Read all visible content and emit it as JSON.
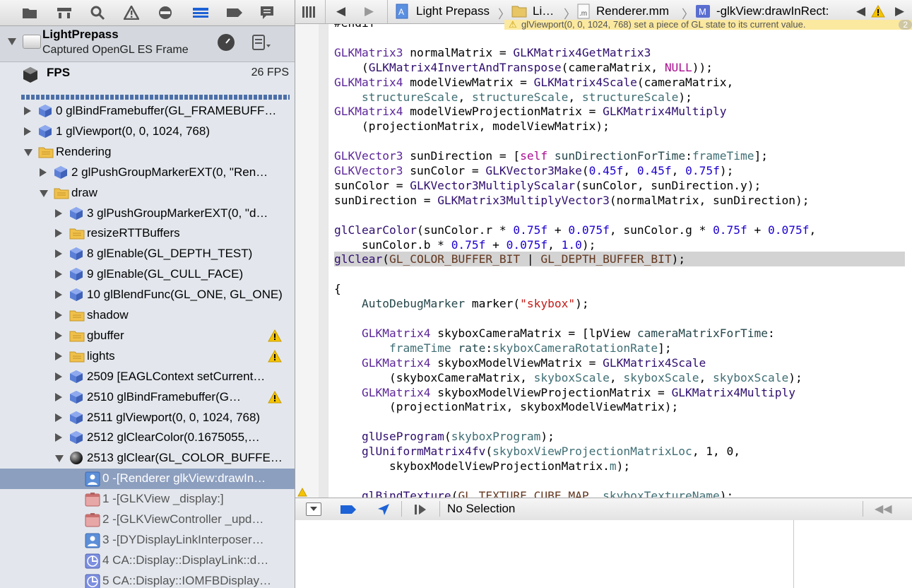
{
  "navigator": {
    "toolbar_icons": [
      "folder-icon",
      "hierarchy-icon",
      "search-icon",
      "warning-icon",
      "breakpoint-filter-icon",
      "debug-navigator-icon",
      "breakpoint-icon",
      "log-icon"
    ],
    "frame_title": "LightPrepass",
    "frame_subtitle": "Captured OpenGL ES Frame",
    "fps_label": "FPS",
    "fps_value": "26 FPS",
    "tree": [
      {
        "label": "0 glBindFramebuffer(GL_FRAMEBUFF…",
        "icon": "cube-icon",
        "indent": 0,
        "disclosure": "closed"
      },
      {
        "label": "1 glViewport(0, 0, 1024, 768)",
        "icon": "cube-icon",
        "indent": 0,
        "disclosure": "closed"
      },
      {
        "label": "Rendering",
        "icon": "folder-icon",
        "indent": 0,
        "disclosure": "open"
      },
      {
        "label": "2 glPushGroupMarkerEXT(0, \"Ren…",
        "icon": "cube-icon",
        "indent": 1,
        "disclosure": "closed"
      },
      {
        "label": "draw",
        "icon": "folder-icon",
        "indent": 1,
        "disclosure": "open"
      },
      {
        "label": "3 glPushGroupMarkerEXT(0, \"d…",
        "icon": "cube-icon",
        "indent": 2,
        "disclosure": "closed"
      },
      {
        "label": "resizeRTTBuffers",
        "icon": "folder-icon",
        "indent": 2,
        "disclosure": "closed"
      },
      {
        "label": "8 glEnable(GL_DEPTH_TEST)",
        "icon": "cube-icon",
        "indent": 2,
        "disclosure": "closed"
      },
      {
        "label": "9 glEnable(GL_CULL_FACE)",
        "icon": "cube-icon",
        "indent": 2,
        "disclosure": "closed"
      },
      {
        "label": "10 glBlendFunc(GL_ONE, GL_ONE)",
        "icon": "cube-icon",
        "indent": 2,
        "disclosure": "closed"
      },
      {
        "label": "shadow",
        "icon": "folder-icon",
        "indent": 2,
        "disclosure": "closed"
      },
      {
        "label": "gbuffer",
        "icon": "folder-icon",
        "indent": 2,
        "disclosure": "closed",
        "warning": true
      },
      {
        "label": "lights",
        "icon": "folder-icon",
        "indent": 2,
        "disclosure": "closed",
        "warning": true
      },
      {
        "label": "2509 [EAGLContext setCurrent…",
        "icon": "cube-icon",
        "indent": 2,
        "disclosure": "closed"
      },
      {
        "label": "2510 glBindFramebuffer(G…",
        "icon": "cube-icon",
        "indent": 2,
        "disclosure": "closed",
        "warning": true
      },
      {
        "label": "2511 glViewport(0, 0, 1024, 768)",
        "icon": "cube-icon",
        "indent": 2,
        "disclosure": "closed"
      },
      {
        "label": "2512 glClearColor(0.1675055,…",
        "icon": "cube-icon",
        "indent": 2,
        "disclosure": "closed"
      },
      {
        "label": "2513 glClear(GL_COLOR_BUFFE…",
        "icon": "sphere-icon",
        "indent": 2,
        "disclosure": "open"
      },
      {
        "label": "0 -[Renderer glkView:drawIn…",
        "icon": "user-frame-icon",
        "indent": 3,
        "disclosure": "none",
        "selected": true
      },
      {
        "label": "1 -[GLKView _display:]",
        "icon": "framework-icon",
        "indent": 3,
        "disclosure": "none",
        "dim": true
      },
      {
        "label": "2 -[GLKViewController _upd…",
        "icon": "framework-icon",
        "indent": 3,
        "disclosure": "none",
        "dim": true
      },
      {
        "label": "3 -[DYDisplayLinkInterposer…",
        "icon": "user-frame-icon",
        "indent": 3,
        "disclosure": "none",
        "dim": true
      },
      {
        "label": "4 CA::Display::DisplayLink::d…",
        "icon": "system-frame-icon",
        "indent": 3,
        "disclosure": "none",
        "dim": true
      },
      {
        "label": "5 CA::Display::IOMFBDisplay…",
        "icon": "system-frame-icon",
        "indent": 3,
        "disclosure": "none",
        "dim": true
      }
    ]
  },
  "jumpbar": {
    "project": "Light Prepass",
    "folder": "Li…",
    "file": "Renderer.mm",
    "method": "-glkView:drawInRect:"
  },
  "issue_banner": {
    "text": "glViewport(0, 0, 1024, 768) set a piece of GL state to its current value.",
    "count": "2"
  },
  "code_lines": [
    [
      {
        "c": "",
        "t": "#endif"
      }
    ],
    [],
    [
      {
        "c": "t",
        "t": "GLKMatrix3"
      },
      {
        "c": "",
        "t": " normalMatrix = "
      },
      {
        "c": "f",
        "t": "GLKMatrix4GetMatrix3"
      }
    ],
    [
      {
        "c": "",
        "t": "    ("
      },
      {
        "c": "f",
        "t": "GLKMatrix4InvertAndTranspose"
      },
      {
        "c": "",
        "t": "(cameraMatrix, "
      },
      {
        "c": "kw",
        "t": "NULL"
      },
      {
        "c": "",
        "t": "));"
      }
    ],
    [
      {
        "c": "t",
        "t": "GLKMatrix4"
      },
      {
        "c": "",
        "t": " modelViewMatrix = "
      },
      {
        "c": "f",
        "t": "GLKMatrix4Scale"
      },
      {
        "c": "",
        "t": "(cameraMatrix,"
      }
    ],
    [
      {
        "c": "",
        "t": "    "
      },
      {
        "c": "m",
        "t": "structureScale"
      },
      {
        "c": "",
        "t": ", "
      },
      {
        "c": "m",
        "t": "structureScale"
      },
      {
        "c": "",
        "t": ", "
      },
      {
        "c": "m",
        "t": "structureScale"
      },
      {
        "c": "",
        "t": ");"
      }
    ],
    [
      {
        "c": "t",
        "t": "GLKMatrix4"
      },
      {
        "c": "",
        "t": " modelViewProjectionMatrix = "
      },
      {
        "c": "f",
        "t": "GLKMatrix4Multiply"
      }
    ],
    [
      {
        "c": "",
        "t": "    (projectionMatrix, modelViewMatrix);"
      }
    ],
    [],
    [
      {
        "c": "t",
        "t": "GLKVector3"
      },
      {
        "c": "",
        "t": " sunDirection = ["
      },
      {
        "c": "kw",
        "t": "self"
      },
      {
        "c": "",
        "t": " "
      },
      {
        "c": "ifn",
        "t": "sunDirectionForTime"
      },
      {
        "c": "",
        "t": ":"
      },
      {
        "c": "m",
        "t": "frameTime"
      },
      {
        "c": "",
        "t": "];"
      }
    ],
    [
      {
        "c": "t",
        "t": "GLKVector3"
      },
      {
        "c": "",
        "t": " sunColor = "
      },
      {
        "c": "f",
        "t": "GLKVector3Make"
      },
      {
        "c": "",
        "t": "("
      },
      {
        "c": "n",
        "t": "0.45f"
      },
      {
        "c": "",
        "t": ", "
      },
      {
        "c": "n",
        "t": "0.45f"
      },
      {
        "c": "",
        "t": ", "
      },
      {
        "c": "n",
        "t": "0.75f"
      },
      {
        "c": "",
        "t": ");"
      }
    ],
    [
      {
        "c": "",
        "t": "sunColor = "
      },
      {
        "c": "f",
        "t": "GLKVector3MultiplyScalar"
      },
      {
        "c": "",
        "t": "(sunColor, sunDirection.y);"
      }
    ],
    [
      {
        "c": "",
        "t": "sunDirection = "
      },
      {
        "c": "f",
        "t": "GLKMatrix3MultiplyVector3"
      },
      {
        "c": "",
        "t": "(normalMatrix, sunDirection);"
      }
    ],
    [],
    [
      {
        "c": "f",
        "t": "glClearColor"
      },
      {
        "c": "",
        "t": "(sunColor.r * "
      },
      {
        "c": "n",
        "t": "0.75f"
      },
      {
        "c": "",
        "t": " + "
      },
      {
        "c": "n",
        "t": "0.075f"
      },
      {
        "c": "",
        "t": ", sunColor.g * "
      },
      {
        "c": "n",
        "t": "0.75f"
      },
      {
        "c": "",
        "t": " + "
      },
      {
        "c": "n",
        "t": "0.075f"
      },
      {
        "c": "",
        "t": ","
      }
    ],
    [
      {
        "c": "",
        "t": "    sunColor.b * "
      },
      {
        "c": "n",
        "t": "0.75f"
      },
      {
        "c": "",
        "t": " + "
      },
      {
        "c": "n",
        "t": "0.075f"
      },
      {
        "c": "",
        "t": ", "
      },
      {
        "c": "n",
        "t": "1.0"
      },
      {
        "c": "",
        "t": ");"
      }
    ],
    [
      {
        "c": "f",
        "t": "glClear"
      },
      {
        "c": "",
        "t": "("
      },
      {
        "c": "mac",
        "t": "GL_COLOR_BUFFER_BIT"
      },
      {
        "c": "",
        "t": " | "
      },
      {
        "c": "mac",
        "t": "GL_DEPTH_BUFFER_BIT"
      },
      {
        "c": "",
        "t": ");"
      }
    ],
    [],
    [
      {
        "c": "",
        "t": "{"
      }
    ],
    [
      {
        "c": "",
        "t": "    "
      },
      {
        "c": "ifn",
        "t": "AutoDebugMarker"
      },
      {
        "c": "",
        "t": " marker("
      },
      {
        "c": "s",
        "t": "\"skybox\""
      },
      {
        "c": "",
        "t": ");"
      }
    ],
    [],
    [
      {
        "c": "",
        "t": "    "
      },
      {
        "c": "t",
        "t": "GLKMatrix4"
      },
      {
        "c": "",
        "t": " skyboxCameraMatrix = [lpView "
      },
      {
        "c": "ifn",
        "t": "cameraMatrixForTime"
      },
      {
        "c": "",
        "t": ":"
      }
    ],
    [
      {
        "c": "",
        "t": "        "
      },
      {
        "c": "m",
        "t": "frameTime"
      },
      {
        "c": "",
        "t": " "
      },
      {
        "c": "ifn",
        "t": "rate"
      },
      {
        "c": "",
        "t": ":"
      },
      {
        "c": "m",
        "t": "skyboxCameraRotationRate"
      },
      {
        "c": "",
        "t": "];"
      }
    ],
    [
      {
        "c": "",
        "t": "    "
      },
      {
        "c": "t",
        "t": "GLKMatrix4"
      },
      {
        "c": "",
        "t": " skyboxModelViewMatrix = "
      },
      {
        "c": "f",
        "t": "GLKMatrix4Scale"
      }
    ],
    [
      {
        "c": "",
        "t": "        (skyboxCameraMatrix, "
      },
      {
        "c": "m",
        "t": "skyboxScale"
      },
      {
        "c": "",
        "t": ", "
      },
      {
        "c": "m",
        "t": "skyboxScale"
      },
      {
        "c": "",
        "t": ", "
      },
      {
        "c": "m",
        "t": "skyboxScale"
      },
      {
        "c": "",
        "t": ");"
      }
    ],
    [
      {
        "c": "",
        "t": "    "
      },
      {
        "c": "t",
        "t": "GLKMatrix4"
      },
      {
        "c": "",
        "t": " skyboxModelViewProjectionMatrix = "
      },
      {
        "c": "f",
        "t": "GLKMatrix4Multiply"
      }
    ],
    [
      {
        "c": "",
        "t": "        (projectionMatrix, skyboxModelViewMatrix);"
      }
    ],
    [],
    [
      {
        "c": "",
        "t": "    "
      },
      {
        "c": "f",
        "t": "glUseProgram"
      },
      {
        "c": "",
        "t": "("
      },
      {
        "c": "m",
        "t": "skyboxProgram"
      },
      {
        "c": "",
        "t": ");"
      }
    ],
    [
      {
        "c": "",
        "t": "    "
      },
      {
        "c": "f",
        "t": "glUniformMatrix4fv"
      },
      {
        "c": "",
        "t": "("
      },
      {
        "c": "m",
        "t": "skyboxViewProjectionMatrixLoc"
      },
      {
        "c": "",
        "t": ", 1, 0,"
      }
    ],
    [
      {
        "c": "",
        "t": "        skyboxModelViewProjectionMatrix."
      },
      {
        "c": "m",
        "t": "m"
      },
      {
        "c": "",
        "t": ");"
      }
    ],
    [],
    [
      {
        "c": "",
        "t": "    "
      },
      {
        "c": "f",
        "t": "glBindTexture"
      },
      {
        "c": "",
        "t": "("
      },
      {
        "c": "mac",
        "t": "GL_TEXTURE_CUBE_MAP"
      },
      {
        "c": "",
        "t": ", "
      },
      {
        "c": "m",
        "t": "skyboxTextureName"
      },
      {
        "c": "",
        "t": ");"
      }
    ]
  ],
  "highlighted_line": 16,
  "debug_bar": {
    "status": "No Selection"
  },
  "colors": {
    "selection": "#8d9fbf",
    "warning": "#f5c400",
    "cube": "#5b7fd6",
    "folder": "#f0c14a"
  }
}
